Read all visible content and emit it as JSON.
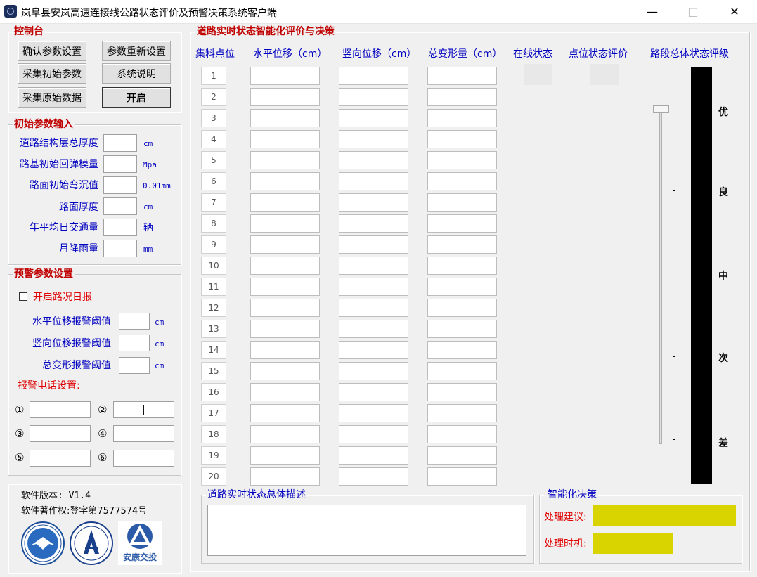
{
  "window": {
    "title": "岚阜县安岚高速连接线公路状态评价及预警决策系统客户端",
    "minimize_glyph": "—",
    "maximize_glyph": "□",
    "close_glyph": "✕"
  },
  "control": {
    "title": "控制台",
    "buttons": {
      "confirm": "确认参数设置",
      "reset": "参数重新设置",
      "collect_initial": "采集初始参数",
      "help": "系统说明",
      "collect_raw": "采集原始数据",
      "start": "开启"
    }
  },
  "init_params": {
    "title": "初始参数输入",
    "fields": [
      {
        "label": "道路结构层总厚度",
        "unit": "cm",
        "value": ""
      },
      {
        "label": "路基初始回弹模量",
        "unit": "Mpa",
        "value": ""
      },
      {
        "label": "路面初始弯沉值",
        "unit": "0.01mm",
        "value": ""
      },
      {
        "label": "路面厚度",
        "unit": "cm",
        "value": ""
      },
      {
        "label": "年平均日交通量",
        "unit": "辆",
        "value": ""
      },
      {
        "label": "月降雨量",
        "unit": "mm",
        "value": ""
      }
    ]
  },
  "warning": {
    "title": "预警参数设置",
    "daily_report_label": "开启路况日报",
    "thresholds": [
      {
        "label": "水平位移报警阈值",
        "unit": "cm",
        "value": ""
      },
      {
        "label": "竖向位移报警阈值",
        "unit": "cm",
        "value": ""
      },
      {
        "label": "总变形报警阈值",
        "unit": "cm",
        "value": ""
      }
    ],
    "phone_title": "报警电话设置:",
    "phones": [
      {
        "num": "①",
        "value": ""
      },
      {
        "num": "②",
        "value": "|"
      },
      {
        "num": "③",
        "value": ""
      },
      {
        "num": "④",
        "value": ""
      },
      {
        "num": "⑤",
        "value": ""
      },
      {
        "num": "⑥",
        "value": ""
      }
    ]
  },
  "software": {
    "version_label": "软件版本:  V1.4",
    "copyright_label": "软件著作权:登字第7577574号",
    "logo3_text": "安康交投"
  },
  "main": {
    "title": "道路实时状态智能化评价与决策",
    "headers": {
      "point": "集料点位",
      "horizontal": "水平位移（cm）",
      "vertical": "竖向位移（cm）",
      "total": "总变形量（cm）",
      "online": "在线状态",
      "point_eval": "点位状态评价",
      "segment_grade": "路段总体状态评级"
    },
    "rows": [
      "1",
      "2",
      "3",
      "4",
      "5",
      "6",
      "7",
      "8",
      "9",
      "10",
      "11",
      "12",
      "13",
      "14",
      "15",
      "16",
      "17",
      "18",
      "19",
      "20"
    ],
    "grades": [
      "优",
      "良",
      "中",
      "次",
      "差"
    ],
    "ticks": [
      "-",
      "-",
      "-",
      "-",
      "-"
    ],
    "slider_level": 1.0
  },
  "description": {
    "title": "道路实时状态总体描述",
    "value": ""
  },
  "decision": {
    "title": "智能化决策",
    "advice_label": "处理建议:",
    "timing_label": "处理时机:",
    "highlight_color": "#d9d400"
  }
}
